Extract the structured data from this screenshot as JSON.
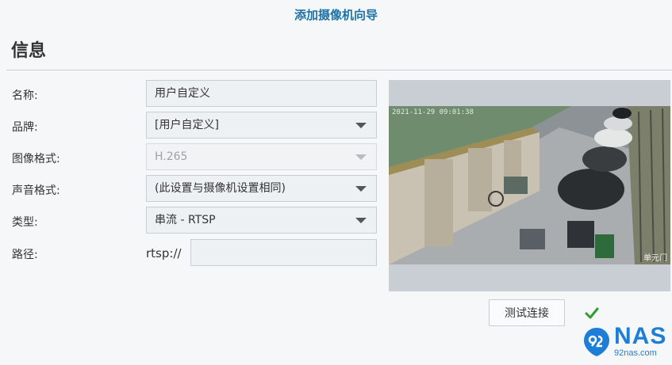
{
  "wizard_title": "添加摄像机向导",
  "section_title": "信息",
  "form": {
    "name_label": "名称:",
    "name_value": "用户自定义",
    "brand_label": "品牌:",
    "brand_value": "[用户自定义]",
    "image_format_label": "图像格式:",
    "image_format_value": "H.265",
    "audio_format_label": "声音格式:",
    "audio_format_value": "(此设置与摄像机设置相同)",
    "type_label": "类型:",
    "type_value": "串流 - RTSP",
    "path_label": "路径:",
    "path_prefix": "rtsp://",
    "path_value": ""
  },
  "preview": {
    "timestamp": "2021-11-29 09:01:38",
    "overlay_label": "单元门"
  },
  "test_button_label": "测试连接",
  "test_status_icon": "checkmark-icon",
  "watermark": {
    "brand": "NAS",
    "site": "92nas.com"
  },
  "colors": {
    "accent": "#1e73a8",
    "success": "#2e9e2e"
  }
}
